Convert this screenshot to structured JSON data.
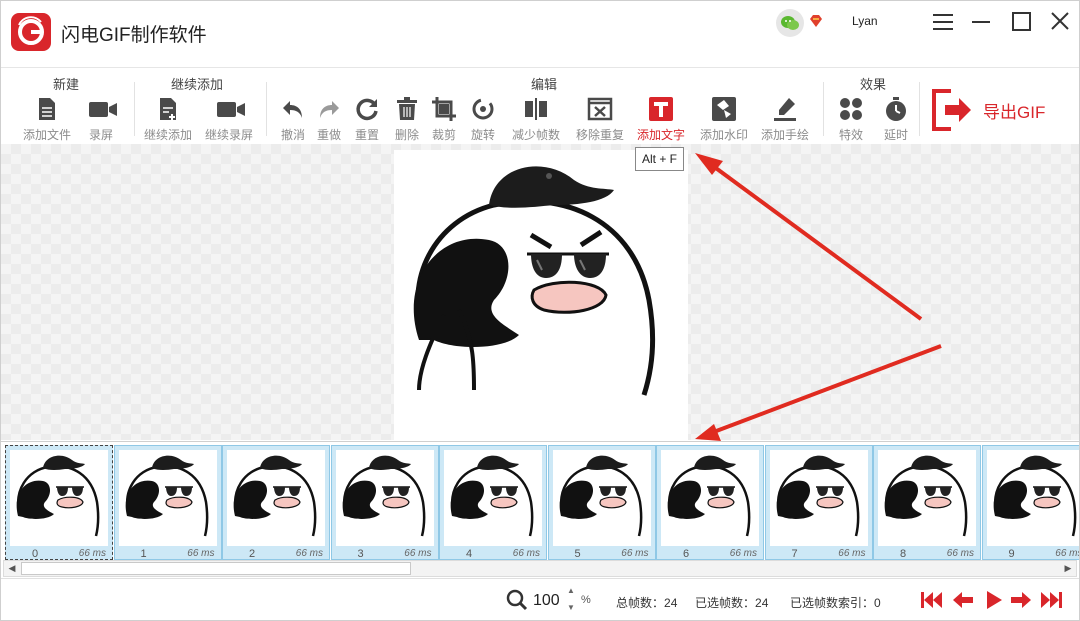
{
  "app": {
    "title": "闪电GIF制作软件",
    "user": "Lyan"
  },
  "ribbon": {
    "groups": {
      "new": "新建",
      "continue": "继续添加",
      "edit": "编辑",
      "effects": "效果"
    },
    "tools": {
      "add_file": "添加文件",
      "record": "录屏",
      "continue_add": "继续添加",
      "continue_record": "继续录屏",
      "undo": "撤消",
      "redo": "重做",
      "reset": "重置",
      "delete": "删除",
      "crop": "裁剪",
      "rotate": "旋转",
      "reduce_frames": "减少帧数",
      "remove_dup": "移除重复",
      "add_text": "添加文字",
      "add_watermark": "添加水印",
      "add_drawing": "添加手绘",
      "effects": "特效",
      "delay": "延时"
    },
    "export": "导出GIF"
  },
  "tooltip": "Alt + F",
  "frames": [
    {
      "index": "0",
      "ms": "66 ms"
    },
    {
      "index": "1",
      "ms": "66 ms"
    },
    {
      "index": "2",
      "ms": "66 ms"
    },
    {
      "index": "3",
      "ms": "66 ms"
    },
    {
      "index": "4",
      "ms": "66 ms"
    },
    {
      "index": "5",
      "ms": "66 ms"
    },
    {
      "index": "6",
      "ms": "66 ms"
    },
    {
      "index": "7",
      "ms": "66 ms"
    },
    {
      "index": "8",
      "ms": "66 ms"
    },
    {
      "index": "9",
      "ms": "66 ms"
    }
  ],
  "status": {
    "zoom": "100",
    "zoom_unit": "%",
    "total_label": "总帧数：",
    "total": "24",
    "selected_label": "已选帧数：",
    "selected": "24",
    "selected_index_label": "已选帧数索引：",
    "selected_index": "0"
  },
  "colors": {
    "accent": "#d9262b",
    "frame_bg": "#cde8f6"
  }
}
